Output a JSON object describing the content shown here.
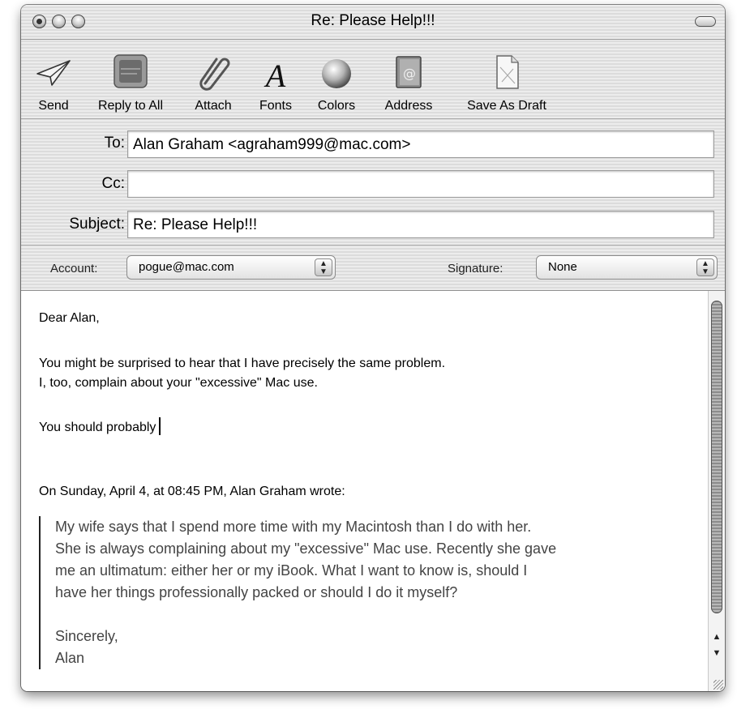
{
  "window": {
    "title": "Re: Please Help!!!"
  },
  "toolbar": {
    "items": [
      {
        "label": "Send",
        "icon": "paper-plane-icon"
      },
      {
        "label": "Reply to All",
        "icon": "reply-all-icon"
      },
      {
        "label": "Attach",
        "icon": "paperclip-icon"
      },
      {
        "label": "Fonts",
        "icon": "font-a-icon"
      },
      {
        "label": "Colors",
        "icon": "color-sphere-icon"
      },
      {
        "label": "Address",
        "icon": "address-book-icon"
      },
      {
        "label": "Save As Draft",
        "icon": "draft-document-icon"
      }
    ]
  },
  "headers": {
    "to_label": "To:",
    "to_value": "Alan Graham <agraham999@mac.com>",
    "cc_label": "Cc:",
    "cc_value": "",
    "subject_label": "Subject:",
    "subject_value": "Re: Please Help!!!"
  },
  "account": {
    "account_label": "Account:",
    "account_value": "pogue@mac.com",
    "signature_label": "Signature:",
    "signature_value": "None"
  },
  "message": {
    "greeting": "Dear Alan,",
    "line1": "You might be surprised to hear that I have precisely the same problem.",
    "line2": "I, too, complain about your \"excessive\" Mac use.",
    "draft": "You should probably",
    "attribution": "On Sunday, April 4, at 08:45 PM, Alan Graham wrote:",
    "quote_lines": [
      "My wife says that I spend more time with my Macintosh than I do with her.",
      "She is always complaining about my \"excessive\" Mac use. Recently she gave",
      "me an ultimatum: either her or my iBook. What I want to know is, should I",
      "have her things professionally packed or should I do it myself?"
    ],
    "signoff": "Sincerely,",
    "signoff_name": "Alan"
  }
}
